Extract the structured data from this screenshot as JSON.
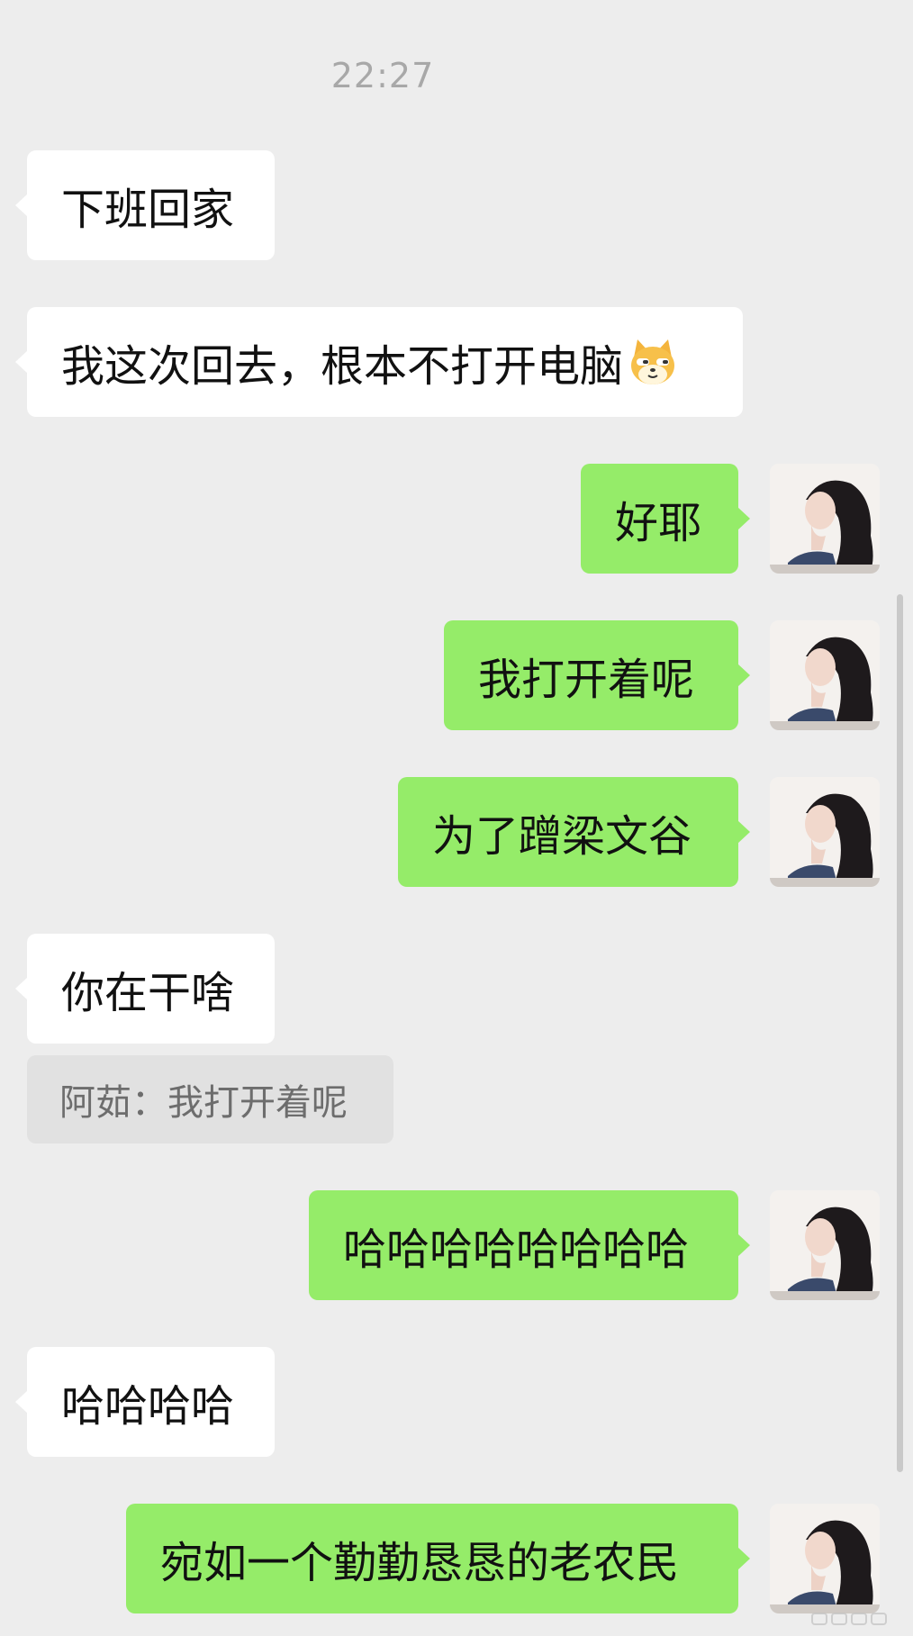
{
  "timestamp": "22:27",
  "messages": [
    {
      "side": "in",
      "text": "下班回家"
    },
    {
      "side": "in",
      "text": "我这次回去，根本不打开电脑",
      "emoji": "doge-cat-emoji"
    },
    {
      "side": "out",
      "text": "好耶"
    },
    {
      "side": "out",
      "text": "我打开着呢"
    },
    {
      "side": "out",
      "text": "为了蹭梁文谷"
    },
    {
      "side": "in",
      "text": "你在干啥"
    },
    {
      "side": "out",
      "text": "哈哈哈哈哈哈哈哈"
    },
    {
      "side": "in",
      "text": "哈哈哈哈"
    },
    {
      "side": "out",
      "text": "宛如一个勤勤恳恳的老农民"
    }
  ],
  "quote": {
    "text": "阿茹：我打开着呢"
  },
  "colors": {
    "background": "#ededed",
    "incoming_bubble": "#ffffff",
    "outgoing_bubble": "#95ec69",
    "quote_bg": "#e1e1e1"
  }
}
